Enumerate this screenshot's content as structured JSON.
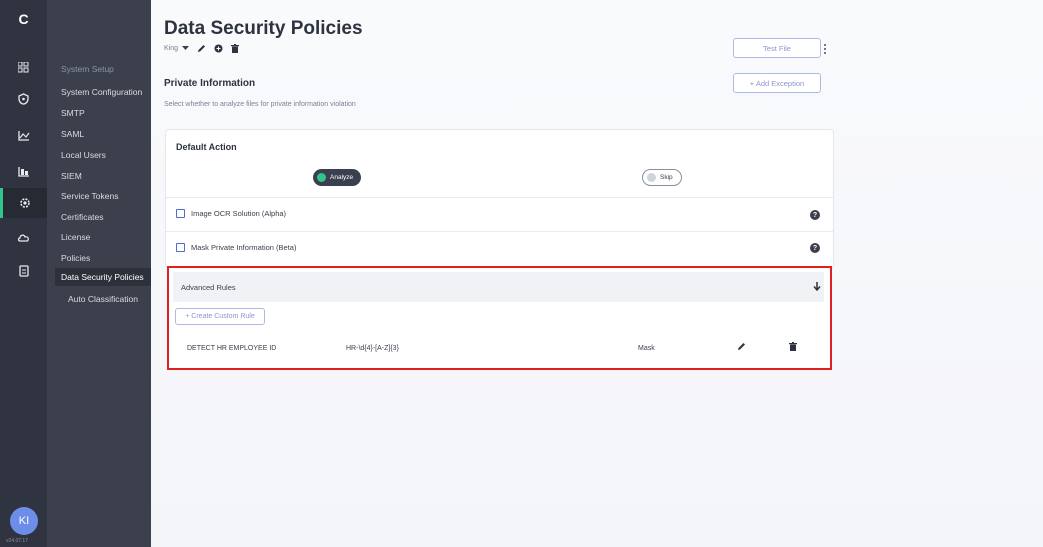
{
  "iconbar": {
    "logo": "C",
    "items": [
      {
        "icon": "grid-icon",
        "glyph": "⊞"
      },
      {
        "icon": "shield-icon",
        "glyph": "⛉"
      },
      {
        "icon": "chart-icon",
        "glyph": "📈"
      },
      {
        "icon": "reports-icon",
        "glyph": "▙"
      },
      {
        "icon": "settings-icon",
        "glyph": "⚙"
      },
      {
        "icon": "cloud-icon",
        "glyph": "☁"
      },
      {
        "icon": "clipboard-icon",
        "glyph": "▤"
      }
    ],
    "avatar": "KI",
    "version": "v24.07.17"
  },
  "submenu": {
    "group_label": "System Setup",
    "items": [
      "System Configuration",
      "SMTP",
      "SAML",
      "Local Users",
      "SIEM",
      "Service Tokens",
      "Certificates",
      "License",
      "Policies",
      "Data Security Policies",
      "Auto Classification"
    ]
  },
  "header": {
    "title": "Data Security Policies",
    "policy_name": "King",
    "test_file_label": "Test File",
    "add_exception_label": "+ Add Exception"
  },
  "section": {
    "title": "Private Information",
    "description": "Select whether to analyze files for private information violation"
  },
  "default_action": {
    "title": "Default Action",
    "analyze_label": "Analyze",
    "skip_label": "Skip",
    "selected": "Analyze"
  },
  "options": [
    {
      "label": "Image OCR Solution (Alpha)",
      "checked": false
    },
    {
      "label": "Mask Private Information (Beta)",
      "checked": false
    }
  ],
  "advanced_rules": {
    "title": "Advanced Rules",
    "create_label": "+ Create Custom Rule",
    "rules": [
      {
        "name": "DETECT HR EMPLOYEE ID",
        "pattern": "HR-\\d{4}-[A-Z]{3}",
        "action": "Mask"
      }
    ]
  },
  "colors": {
    "accent_green": "#31c48d",
    "highlight_red": "#e02020",
    "sidebar_dark": "#2f3440"
  }
}
